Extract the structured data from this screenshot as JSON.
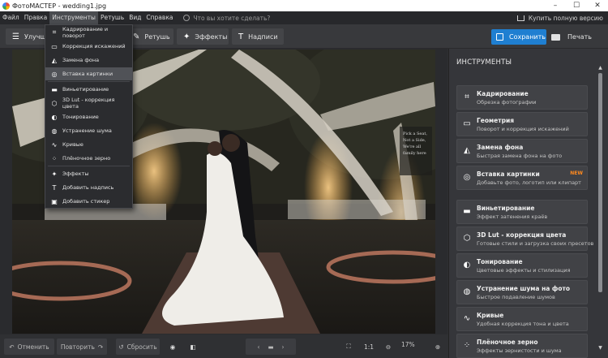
{
  "window": {
    "title": "ФотоМАСТЕР - wedding1.jpg",
    "controls": [
      "–",
      "☐",
      "✕"
    ]
  },
  "menubar": {
    "items": [
      "Файл",
      "Правка",
      "Инструменты",
      "Ретушь",
      "Вид",
      "Справка"
    ],
    "active_index": 2,
    "search_placeholder": "Что вы хотите сделать?",
    "buy_label": "Купить полную версию"
  },
  "toolbar": {
    "tabs": [
      {
        "label": "Улучшение",
        "icon": "sliders-icon"
      },
      {
        "label": "Ретушь",
        "icon": "brush-icon"
      },
      {
        "label": "Эффекты",
        "icon": "magic-wand-icon"
      },
      {
        "label": "Надписи",
        "icon": "text-icon"
      }
    ],
    "save_label": "Сохранить",
    "print_label": "Печать"
  },
  "dropdown": {
    "items": [
      {
        "label": "Кадрирование и поворот",
        "icon": "crop-icon"
      },
      {
        "label": "Коррекция искажений",
        "icon": "geometry-icon"
      },
      {
        "label": "Замена фона",
        "icon": "background-icon"
      },
      {
        "label": "Вставка картинки",
        "icon": "insert-image-icon"
      },
      {
        "label": "Виньетирование",
        "icon": "vignette-icon"
      },
      {
        "label": "3D Lut - коррекция цвета",
        "icon": "cube-icon"
      },
      {
        "label": "Тонирование",
        "icon": "toning-icon"
      },
      {
        "label": "Устранение шума",
        "icon": "noise-icon"
      },
      {
        "label": "Кривые",
        "icon": "curves-icon"
      },
      {
        "label": "Плёночное зерно",
        "icon": "grain-icon"
      },
      {
        "label": "Эффекты",
        "icon": "effects-icon"
      },
      {
        "label": "Добавить надпись",
        "icon": "text-icon"
      },
      {
        "label": "Добавить стикер",
        "icon": "sticker-icon"
      }
    ],
    "highlighted_index": 3
  },
  "panel": {
    "title": "ИНСТРУМЕНТЫ",
    "tools": [
      {
        "title": "Кадрирование",
        "desc": "Обрезка фотографии",
        "icon": "crop-icon"
      },
      {
        "title": "Геометрия",
        "desc": "Поворот и коррекция искажений",
        "icon": "geometry-icon"
      },
      {
        "title": "Замена фона",
        "desc": "Быстрая замена фона на фото",
        "icon": "background-icon"
      },
      {
        "title": "Вставка картинки",
        "desc": "Добавьте фото, логотип или клипарт",
        "icon": "insert-image-icon",
        "badge": "NEW"
      },
      {
        "title": "Виньетирование",
        "desc": "Эффект затенения краёв",
        "icon": "vignette-icon"
      },
      {
        "title": "3D Lut - коррекция цвета",
        "desc": "Готовые стили и загрузка своих пресетов",
        "icon": "cube-icon"
      },
      {
        "title": "Тонирование",
        "desc": "Цветовые эффекты и стилизация",
        "icon": "toning-icon"
      },
      {
        "title": "Устранение шума на фото",
        "desc": "Быстрое подавление шумов",
        "icon": "noise-icon"
      },
      {
        "title": "Кривые",
        "desc": "Удобная коррекция тона и цвета",
        "icon": "curves-icon"
      },
      {
        "title": "Плёночное зерно",
        "desc": "Эффекты зернистости и шума",
        "icon": "grain-icon"
      }
    ]
  },
  "bottombar": {
    "undo_label": "Отменить",
    "redo_label": "Повторить",
    "reset_label": "Сбросить",
    "ratio_label": "1:1",
    "zoom_value": "17%"
  },
  "photo": {
    "sign_lines": [
      "Pick a Seat,",
      "Not a Side,",
      "We're all",
      "family here"
    ]
  },
  "colors": {
    "accent": "#1f7fd1",
    "badge": "#ff8a1f",
    "panel": "#35363a",
    "menu": "#2b2c2f"
  }
}
